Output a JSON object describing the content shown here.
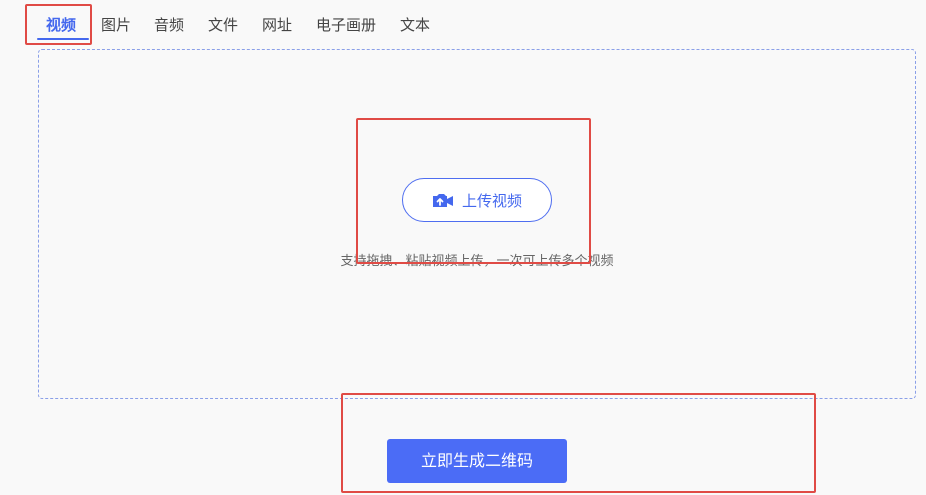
{
  "tabs": [
    {
      "label": "视频",
      "active": true
    },
    {
      "label": "图片"
    },
    {
      "label": "音频"
    },
    {
      "label": "文件"
    },
    {
      "label": "网址"
    },
    {
      "label": "电子画册"
    },
    {
      "label": "文本"
    }
  ],
  "dropzone": {
    "upload_label": "上传视频",
    "upload_icon": "upload-video-icon",
    "hint": "支持拖拽、粘贴视频上传，一次可上传多个视频"
  },
  "generate": {
    "label": "立即生成二维码"
  },
  "colors": {
    "accent": "#4468ee",
    "annotation": "#e04b45"
  }
}
